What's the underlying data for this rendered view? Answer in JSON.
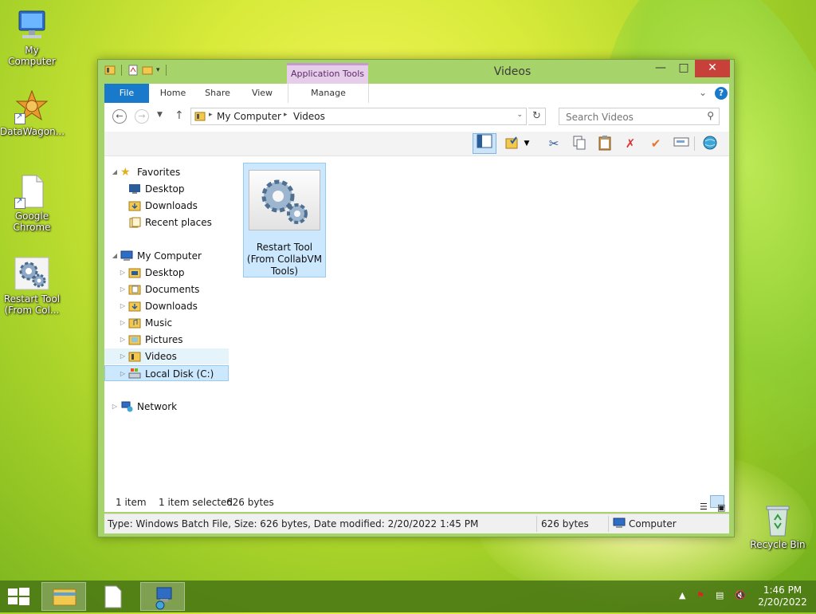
{
  "desktop": {
    "icons": [
      {
        "label": "My Computer"
      },
      {
        "label": "DataWagon..."
      },
      {
        "label": "Google Chrome"
      },
      {
        "label": "Restart Tool (From Col..."
      },
      {
        "label": "Recycle Bin"
      }
    ]
  },
  "window": {
    "title": "Videos",
    "app_tools_label": "Application Tools",
    "ribbon_tabs": {
      "file": "File",
      "home": "Home",
      "share": "Share",
      "view": "View",
      "manage": "Manage"
    },
    "address": {
      "segments": [
        "My Computer",
        "Videos"
      ]
    },
    "search": {
      "placeholder": "Search Videos"
    },
    "nav": {
      "favorites": "Favorites",
      "fav_items": [
        "Desktop",
        "Downloads",
        "Recent places"
      ],
      "my_computer": "My Computer",
      "pc_items": [
        "Desktop",
        "Documents",
        "Downloads",
        "Music",
        "Pictures",
        "Videos",
        "Local Disk (C:)"
      ],
      "network": "Network"
    },
    "file": {
      "name": "Restart Tool (From CollabVM Tools)"
    },
    "status": {
      "count": "1 item",
      "selected": "1 item selected",
      "size": "626 bytes"
    },
    "details": {
      "info": "Type: Windows Batch File, Size: 626 bytes, Date modified: 2/20/2022 1:45 PM",
      "size": "626 bytes",
      "location": "Computer"
    }
  },
  "taskbar": {
    "time": "1:46 PM",
    "date": "2/20/2022"
  },
  "colors": {
    "file_tab": "#1979ca",
    "app_tools": "#e6cde9",
    "selection": "#cce8ff",
    "close_button": "#c7403a",
    "window_frame": "#a6d36a"
  }
}
